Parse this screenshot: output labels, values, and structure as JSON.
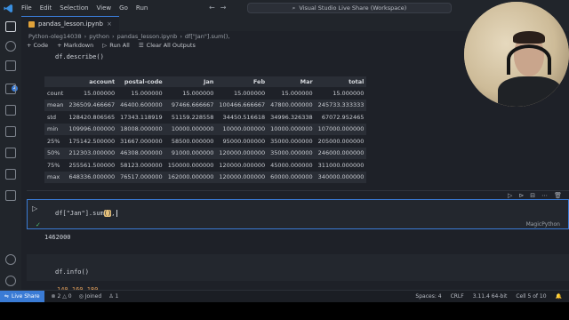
{
  "menu": [
    "File",
    "Edit",
    "Selection",
    "View",
    "Go",
    "Run"
  ],
  "window_title": "Visual Studio Live Share (Workspace)",
  "tab": {
    "label": "pandas_lesson.ipynb"
  },
  "breadcrumb": [
    "Python-oleg14038",
    "python",
    "pandas_lesson.ipynb",
    "df[\"Jan\"].sum(),"
  ],
  "toolbar": {
    "code": "+ Code",
    "markdown": "+ Markdown",
    "run_all": "Run All",
    "clear": "Clear All Outputs"
  },
  "cell1_code": "df.describe()",
  "table": {
    "columns": [
      "",
      "account",
      "postal-code",
      "Jan",
      "Feb",
      "Mar",
      "total"
    ],
    "rows": [
      [
        "count",
        "15.000000",
        "15.000000",
        "15.000000",
        "15.000000",
        "15.000000",
        "15.000000"
      ],
      [
        "mean",
        "236509.466667",
        "46400.600000",
        "97466.666667",
        "100466.666667",
        "47800.000000",
        "245733.333333"
      ],
      [
        "std",
        "128420.806565",
        "17343.118919",
        "51159.228558",
        "34450.516618",
        "34996.326338",
        "67072.952465"
      ],
      [
        "min",
        "109996.000000",
        "18008.000000",
        "10000.000000",
        "10000.000000",
        "10000.000000",
        "107000.000000"
      ],
      [
        "25%",
        "175142.500000",
        "31667.000000",
        "58500.000000",
        "95000.000000",
        "35000.000000",
        "205000.000000"
      ],
      [
        "50%",
        "212303.000000",
        "46308.000000",
        "91000.000000",
        "120000.000000",
        "35000.000000",
        "246000.000000"
      ],
      [
        "75%",
        "255561.500000",
        "58123.000000",
        "150000.000000",
        "120000.000000",
        "45000.000000",
        "311000.000000"
      ],
      [
        "max",
        "648336.000000",
        "76517.000000",
        "162000.000000",
        "120000.000000",
        "60000.000000",
        "340000.000000"
      ]
    ]
  },
  "active_cell": {
    "code_pre": "df[\"Jan\"].sum",
    "paren": "()",
    "code_post": ",",
    "language": "MagicPython"
  },
  "result": "1462000",
  "cell3_code": "df.info()",
  "cell3_output": "140 160 180",
  "status": {
    "live_share": "Live Share",
    "errors": "2",
    "warnings": "0",
    "joined": "Joined",
    "participants": "1",
    "spaces": "Spaces: 4",
    "eol": "CRLF",
    "interpreter": "3.11.4 64-bit",
    "cell": "Cell 5 of 10"
  },
  "colors": {
    "accent": "#3a7bd5",
    "background": "#1e2128",
    "sidebar": "#21252b"
  },
  "icons": [
    "vscode-logo-icon",
    "explorer-icon",
    "search-icon",
    "source-control-icon",
    "run-debug-icon",
    "extensions-icon",
    "accounts-icon",
    "settings-icon"
  ]
}
